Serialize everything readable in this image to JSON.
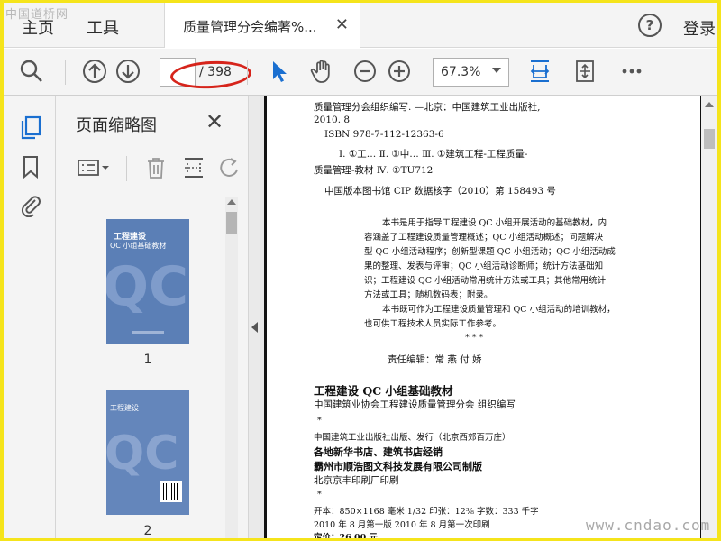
{
  "watermark_top": "中国道桥网",
  "watermark_bottom": "www.cndao.com",
  "tabs": {
    "home": "主页",
    "tools": "工具",
    "document": "质量管理分会编著%...",
    "login": "登录"
  },
  "toolbar": {
    "current_page": "",
    "total_pages": "/ 398",
    "zoom": "67.3%"
  },
  "panel": {
    "title": "页面缩略图",
    "thumbnails": [
      {
        "label": "1",
        "cover_title": "工程建设",
        "cover_subtitle": "QC 小组基础教材"
      },
      {
        "label": "2",
        "cover_title": "工程建设"
      }
    ]
  },
  "document_page": {
    "lines": [
      "质量管理分会组织编写. —北京：中国建筑工业出版社,",
      "2010. 8",
      "ISBN 978-7-112-12363-6",
      "Ⅰ. ①工…  Ⅱ. ①中…  Ⅲ. ①建筑工程-工程质量-",
      "质量管理-教材  Ⅳ. ①TU712",
      "中国版本图书馆 CIP 数据核字（2010）第 158493 号",
      "本书是用于指导工程建设 QC 小组开展活动的基础教材，内",
      "容涵盖了工程建设质量管理概述；QC 小组活动概述；问题解决",
      "型 QC 小组活动程序；创新型课题 QC 小组活动；QC 小组活动成",
      "果的整理、发表与评审；QC 小组活动诊断师；统计方法基础知",
      "识；工程建设 QC 小组活动常用统计方法或工具；其他常用统计",
      "方法或工具；随机数码表；附录。",
      "本书既可作为工程建设质量管理和 QC 小组活动的培训教材，",
      "也可供工程技术人员实际工作参考。",
      "*        *        *",
      "责任编辑：常   燕   付   娇",
      "工程建设 QC 小组基础教材",
      "中国建筑业协会工程建设质量管理分会   组织编写",
      "*",
      "中国建筑工业出版社出版、发行（北京西郊百万庄）",
      "各地新华书店、建筑书店经销",
      "霸州市顺浩图文科技发展有限公司制版",
      "北京京丰印刷厂印刷",
      "*",
      "开本：850×1168 毫米   1/32   印张：12⅜   字数：333 千字",
      "2010 年 8 月第一版      2010 年 8 月第一次印刷",
      "定价：26.00 元"
    ]
  },
  "colors": {
    "frame_border": "#f5e41b",
    "accent_blue": "#1a6fd0",
    "annotation_red": "#d6241b",
    "cover_blue": "#5b7fb6"
  }
}
